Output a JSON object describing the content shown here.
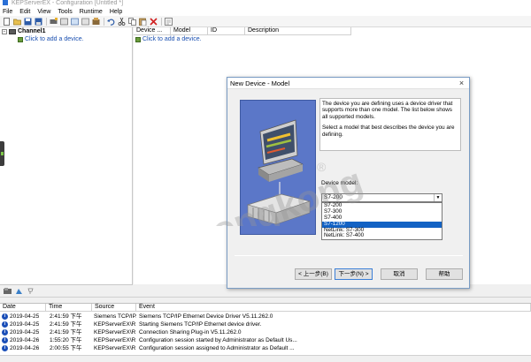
{
  "window": {
    "title": "KEPServerEX - Configuration [Untitled *]"
  },
  "menu": [
    "File",
    "Edit",
    "View",
    "Tools",
    "Runtime",
    "Help"
  ],
  "tree": {
    "channel": "Channel1",
    "add_device": "Click to add a device."
  },
  "device_table": {
    "columns": [
      "Device ...",
      "Model",
      "ID",
      "Description"
    ],
    "add_device": "Click to add a device."
  },
  "dialog": {
    "title": "New Device - Model",
    "description_1": "The device you are defining uses a device driver that supports more than one model.  The list below shows all supported models.",
    "description_2": "Select  a model that best describes the device you are defining.",
    "model_label": "Device model:",
    "selected_model": "S7-200",
    "options": [
      "S7-200",
      "S7-300",
      "S7-400",
      "S7-1200",
      "NetLink: S7-300",
      "NetLink: S7-400"
    ],
    "highlighted_option": "S7-1200",
    "buttons": {
      "back": "< 上一步(B)",
      "next": "下一步(N) >",
      "cancel": "取消",
      "help": "帮助"
    }
  },
  "watermark": {
    "text": "gongkong",
    "mark": "®"
  },
  "log": {
    "columns": [
      "Date",
      "Time",
      "Source",
      "Event"
    ],
    "rows": [
      {
        "date": "2019-04-25",
        "time": "2:41:59 下午",
        "source": "Siemens TCP/IP...",
        "event": "Siemens TCP/IP Ethernet Device Driver V5.11.262.0"
      },
      {
        "date": "2019-04-25",
        "time": "2:41:59 下午",
        "source": "KEPServerEX\\R...",
        "event": "Starting Siemens TCP/IP Ethernet device driver."
      },
      {
        "date": "2019-04-25",
        "time": "2:41:59 下午",
        "source": "KEPServerEX\\R...",
        "event": "Connection Sharing Plug-in V5.11.262.0"
      },
      {
        "date": "2019-04-26",
        "time": "1:55:20 下午",
        "source": "KEPServerEX\\R...",
        "event": "Configuration session started by Administrator as Default Us..."
      },
      {
        "date": "2019-04-26",
        "time": "2:00:55 下午",
        "source": "KEPServerEX\\R...",
        "event": "Configuration session assigned to Administrator as Default ..."
      }
    ]
  },
  "colors": {
    "selection": "#1262c4",
    "link": "#1a4fb0",
    "info": "#1b4fb8",
    "dialog_image": "#5b77c8"
  },
  "icons": [
    "new-icon",
    "open-icon",
    "save-icon",
    "save-as-icon",
    "new-channel-icon",
    "new-device-icon",
    "new-tag-icon",
    "new-group-icon",
    "import-icon",
    "undo-icon",
    "cut-icon",
    "copy-icon",
    "paste-icon",
    "delete-icon",
    "properties-icon",
    "info-icon"
  ]
}
